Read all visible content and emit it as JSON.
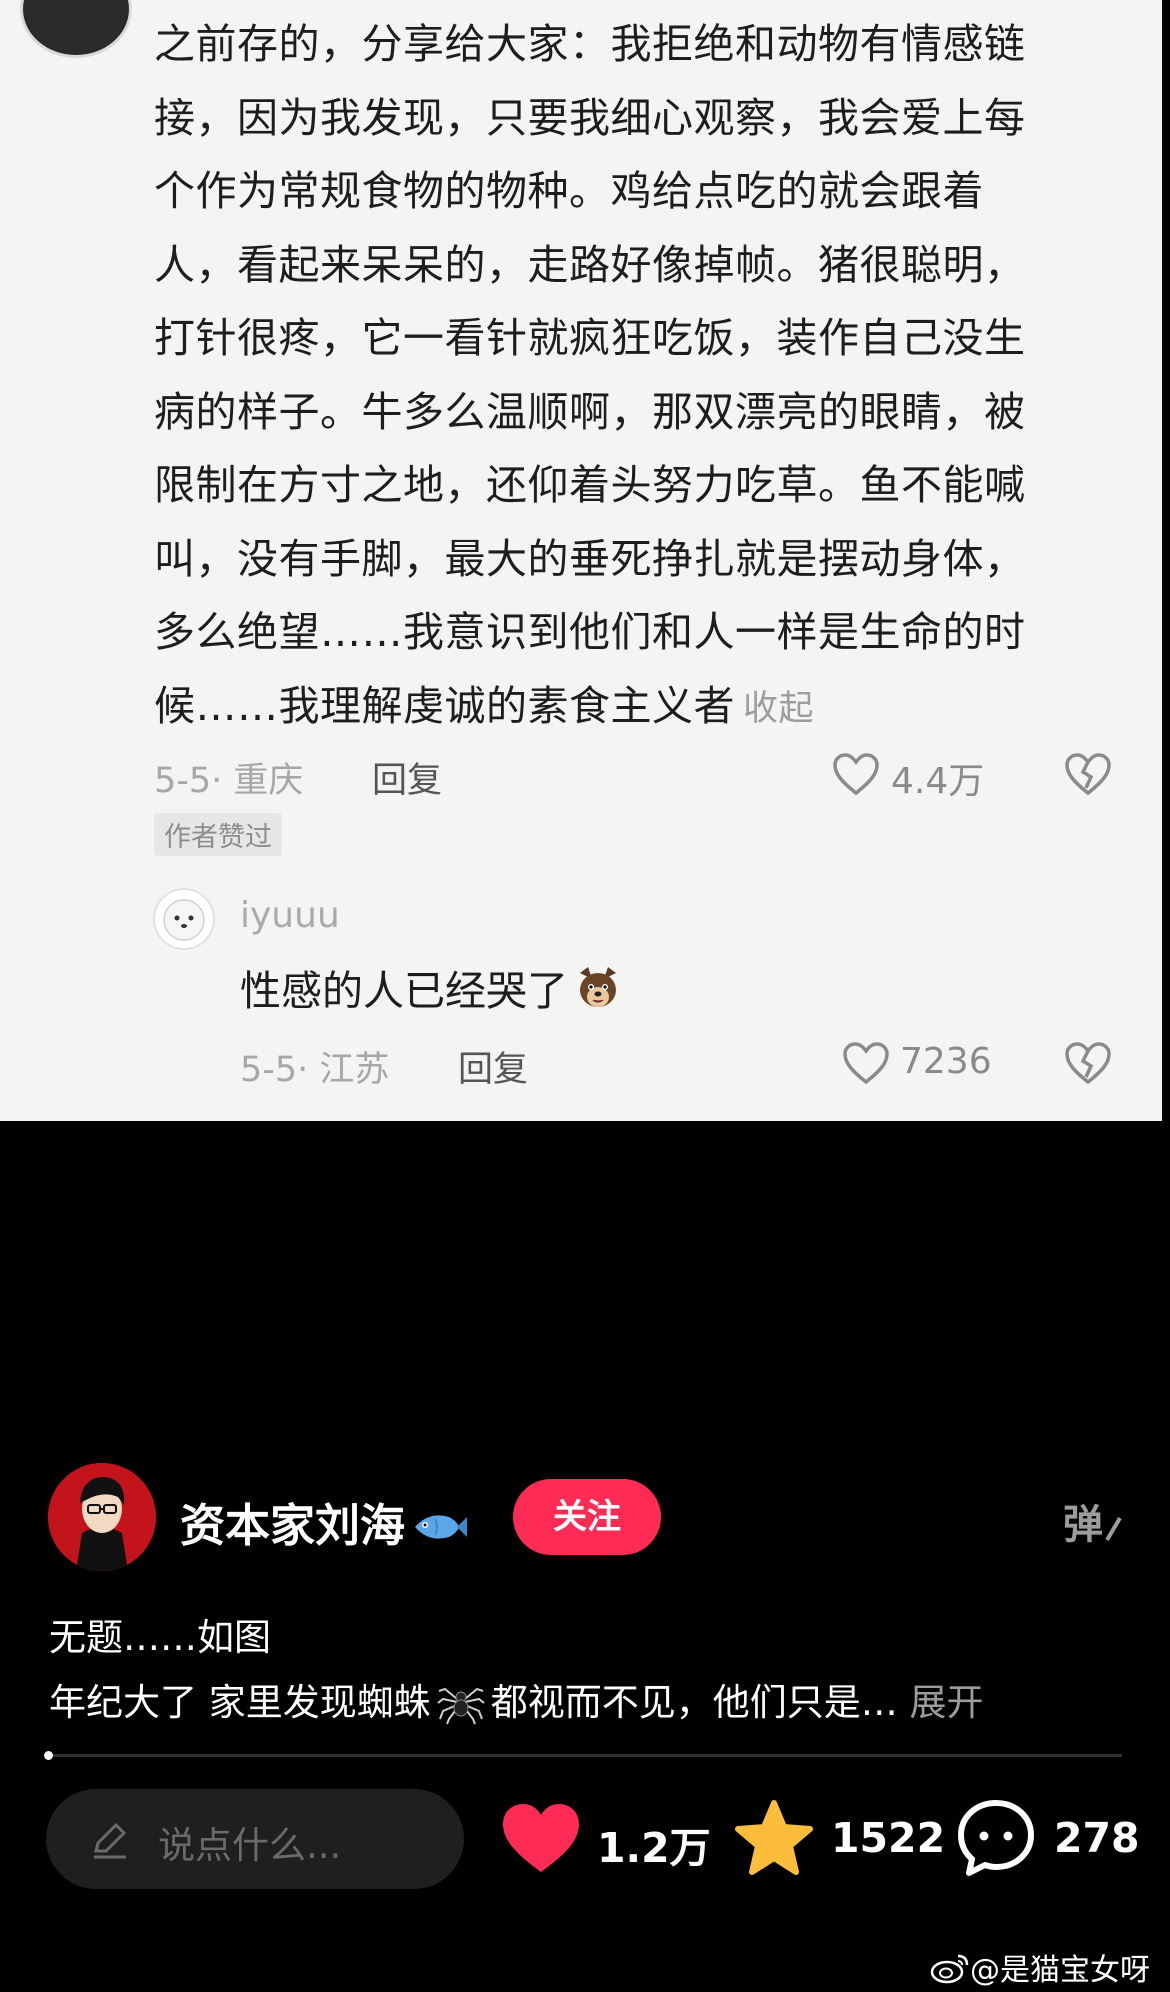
{
  "comment": {
    "lines": [
      "之前存的，分享给大家：我拒绝和动物有情感链",
      "接，因为我发现，只要我细心观察，我会爱上每",
      "个作为常规食物的物种。鸡给点吃的就会跟着",
      "人，看起来呆呆的，走路好像掉帧。猪很聪明，",
      "打针很疼，它一看针就疯狂吃饭，装作自己没生",
      "病的样子。牛多么温顺啊，那双漂亮的眼睛，被",
      "限制在方寸之地，还仰着头努力吃草。鱼不能喊",
      "叫，没有手脚，最大的垂死挣扎就是摆动身体，",
      "多么绝望……我意识到他们和人一样是生命的时",
      "候……我理解虔诚的素食主义者"
    ],
    "collapse_label": "收起",
    "date_location": "5-5· 重庆",
    "reply_label": "回复",
    "like_count": "4.4万",
    "author_liked_badge": "作者赞过"
  },
  "sub_comment": {
    "username": "iyuuu",
    "text": "性感的人已经哭了",
    "date_location": "5-5· 江苏",
    "reply_label": "回复",
    "like_count": "7236"
  },
  "author": {
    "name": "资本家刘海",
    "follow_label": "关注",
    "danmu_label": "弹"
  },
  "description": {
    "line1": "无题……如图",
    "line2_part1": "年纪大了 家里发现蜘蛛",
    "line2_part2": "都视而不见，他们只是…",
    "expand_label": "展开"
  },
  "video": {
    "progress": 0.0
  },
  "bottom_bar": {
    "input_placeholder": "说点什么...",
    "likes": "1.2万",
    "favorites": "1522",
    "comments": "278"
  },
  "watermark": "@是猫宝女呀",
  "colors": {
    "follow": "#fe2c55",
    "heart": "#fe2c55",
    "star": "#fcbd3a",
    "light_bg": "#f4f4f3",
    "dark_bg": "#000000"
  },
  "icons": [
    "heart-outline-icon",
    "broken-heart-icon",
    "dog-emoji-icon",
    "fish-emoji-icon",
    "spider-emoji-icon",
    "pencil-icon",
    "heart-filled-icon",
    "star-icon",
    "comment-bubble-icon",
    "weibo-icon"
  ]
}
